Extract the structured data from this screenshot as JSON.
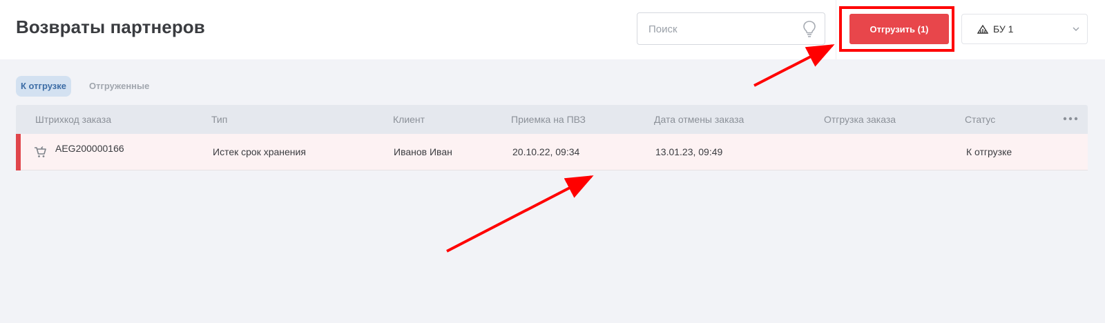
{
  "page": {
    "title": "Возвраты партнеров"
  },
  "search": {
    "placeholder": "Поиск",
    "value": "",
    "icon": "lightbulb-icon"
  },
  "toolbar": {
    "ship_label": "Отгрузить (1)",
    "unit_label": "БУ 1",
    "unit_icon": "warehouse-icon"
  },
  "tabs": [
    {
      "label": "К отгрузке",
      "active": true
    },
    {
      "label": "Отгруженные",
      "active": false
    }
  ],
  "table": {
    "columns": [
      "Штрихкод заказа",
      "Тип",
      "Клиент",
      "Приемка на ПВЗ",
      "Дата отмены заказа",
      "Отгрузка заказа",
      "Статус"
    ],
    "rows": [
      {
        "barcode": "AEG200000166",
        "type": "Истек срок хранения",
        "client": "Иванов Иван",
        "received": "20.10.22, 09:34",
        "cancel_date": "13.01.23, 09:49",
        "shipment": "",
        "status": "К отгрузке"
      }
    ]
  },
  "colors": {
    "accent_red": "#e8464b",
    "active_tab_bg": "#d3e1f1",
    "active_tab_text": "#3d6da6",
    "row_highlight": "#fdf2f3",
    "annotation_red": "#ff0000"
  }
}
